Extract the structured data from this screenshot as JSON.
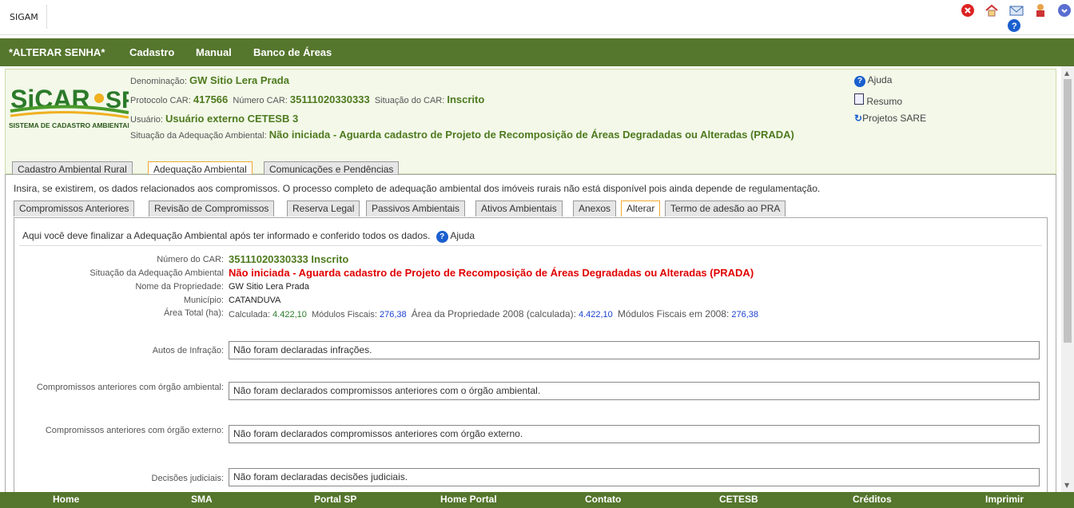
{
  "app": {
    "title": "SIGAM"
  },
  "top_icons": [
    "close-icon",
    "home-icon",
    "mail-icon",
    "user-icon",
    "help-icon",
    "help-icon",
    "logout-icon"
  ],
  "nav": [
    "*ALTERAR SENHA*",
    "Cadastro",
    "Manual",
    "Banco de Áreas"
  ],
  "logo": {
    "text": "SICAR SP",
    "subtitle": "SISTEMA DE CADASTRO AMBIENTAL RURAL"
  },
  "header": {
    "denominacao_label": "Denominação:",
    "denominacao": "GW Sitio Lera Prada",
    "protocolo_label": "Protocolo CAR:",
    "protocolo": "417566",
    "numero_label": "Número CAR:",
    "numero": "35111020330333",
    "situacao_label": "Situação do CAR:",
    "situacao": "Inscrito",
    "usuario_label": "Usuário:",
    "usuario": "Usuário externo CETESB 3",
    "adequacao_label": "Situação da Adequação Ambiental:",
    "adequacao": "Não iniciada - Aguarda cadastro de Projeto de Recomposição de Áreas Degradadas ou Alteradas (PRADA)"
  },
  "side_links": [
    "Ajuda",
    "Resumo",
    "Projetos SARE"
  ],
  "tabs1": [
    "Cadastro Ambiental Rural",
    "Adequação Ambiental",
    "Comunicações e Pendências"
  ],
  "intro": "Insira, se existirem, os dados relacionados aos compromissos. O processo completo de adequação ambiental dos imóveis rurais não está disponível pois ainda depende de regulamentação.",
  "tabs2": [
    "Compromissos Anteriores",
    "Revisão de Compromissos",
    "Reserva Legal",
    "Passivos Ambientais",
    "Ativos Ambientais",
    "Anexos",
    "Alterar",
    "Termo de adesão ao PRA"
  ],
  "guide": "Aqui você deve finalizar a Adequação Ambiental após ter informado e conferido todos os dados.",
  "guide_help": "Ajuda",
  "details": {
    "numero_label": "Número do CAR:",
    "numero": "35111020330333 Inscrito",
    "situacao_label": "Situação da Adequação Ambiental",
    "situacao": "Não iniciada - Aguarda cadastro de Projeto de Recomposição de Áreas Degradadas ou Alteradas (PRADA)",
    "nome_label": "Nome da Propriedade:",
    "nome": "GW Sitio Lera Prada",
    "municipio_label": "Município:",
    "municipio": "CATANDUVA",
    "area_label": "Área Total (ha):",
    "calc_label": "Calculada:",
    "calc": "4.422,10",
    "mod_label": "Módulos Fiscais:",
    "mod": "276,38",
    "area2008_label": "Área da Propriedade 2008 (calculada):",
    "area2008": "4.422,10",
    "mod2008_label": "Módulos Fiscais em 2008:",
    "mod2008": "276,38"
  },
  "fields": [
    {
      "label": "Autos de Infração:",
      "value": "Não foram declaradas infrações."
    },
    {
      "label": "Compromissos anteriores com órgão ambiental:",
      "value": "Não foram declarados compromissos anteriores com o órgão ambiental."
    },
    {
      "label": "Compromissos anteriores com órgão externo:",
      "value": "Não foram declarados compromissos anteriores com órgão externo."
    },
    {
      "label": "Decisões judiciais:",
      "value": "Não foram declaradas decisões judiciais."
    }
  ],
  "footer": [
    "Home",
    "SMA",
    "Portal SP",
    "Home Portal",
    "Contato",
    "CETESB",
    "Créditos",
    "Imprimir"
  ],
  "colors": {
    "nav": "#55762d",
    "accent": "#4e7a1e",
    "alert": "#e00000"
  }
}
